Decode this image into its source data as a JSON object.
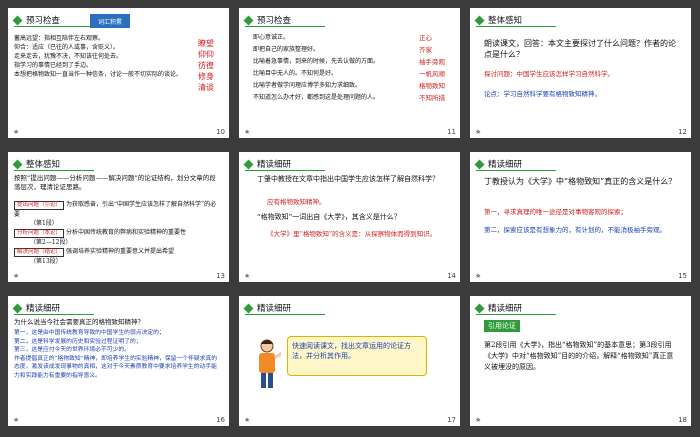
{
  "slides": [
    {
      "num": "10",
      "title": "预习检查",
      "banner": "词汇积累",
      "lines": [
        "蓄高远望：指相互陪伴左右观察。",
        "仰合：适应（已往的人或事，含贬义）。",
        "走来走去，犹豫不决，不知该往何处去。",
        "指学习的事情已经到了手边。",
        "本想把格物致知一直当作一种信条，讨论一般不切实际的谈论。"
      ],
      "side": [
        "瞭望",
        "仰仰",
        "彷徨",
        "修身",
        "清谈"
      ]
    },
    {
      "num": "11",
      "title": "预习检查",
      "lines": [
        "即心意诚正。",
        "即把自己的家族整理好。",
        "比喻着急事情，到来的时候，先去认做的方面。",
        "比喻目中无人的。不知何是好。",
        "比喻学者做学问理应博学多知力求细致。",
        "不知道怎么办才好，都感到这是处理问题的人。"
      ],
      "side": [
        "正心",
        "齐家",
        "袖手旁观",
        "一帆风顺",
        "格物致知",
        "不知所措"
      ]
    },
    {
      "num": "12",
      "title": "整体感知",
      "q": "朗读课文，回答：本文主要探讨了什么问题？作者的论点是什么？",
      "a1": "探讨问题：中国学生应该怎样学习自然科学。",
      "a2": "论点：学习自然科学要有格物致知精神。"
    },
    {
      "num": "13",
      "title": "整体感知",
      "intro": "按照“提出问题——分析问题——解决问题”的论证结构，划分文章的段落层次，理清论证思路。",
      "parts": [
        {
          "label": "提出问题（引论）",
          "range": "（第1段）",
          "desc": "为获取感奋，引出“中国学生应该怎样了解自然科学”的必要"
        },
        {
          "label": "分析问题（本论）",
          "range": "（第2—12段）",
          "desc": "分析中国传统教育的弊病和实验精神的重要性"
        },
        {
          "label": "解决问题（结论）",
          "range": "（第13段）",
          "desc": "强调培养实验精神的重要意义并提出希望"
        }
      ]
    },
    {
      "num": "14",
      "title": "精读细研",
      "q1": "丁肇中教授在文章中指出中国学生应该怎样了解自然科学？",
      "a1": "应有格物致知精神。",
      "q2": "“格物致知”一词出自《大学》，其含义是什么？",
      "a2": "《大学》里“格物致知”的含义是：从探察物体而得到知识。"
    },
    {
      "num": "15",
      "title": "精读细研",
      "q": "丁教授认为《大学》中“格物致知”真正的含义是什么？",
      "a1": "第一，寻求真理的唯一途径是对事物客观的探索；",
      "a2": "第二，探索应该是有想象力的，有计划的，不能消极袖手旁观。"
    },
    {
      "num": "16",
      "title": "精读细研",
      "q": "为什么说当今社会需要真正的格物致知精神？",
      "lines": [
        "第一，这是由中国传统教育导致的中国学生的弱点决定的；",
        "第二，这是科学发展的历史和实验过程证明了的；",
        "第三，这是应付今天的世界环境必不可少的。",
        "作者提倡真正的“格物致知”精神，即培养学生的实验精神，保留一个怀疑求真的态度，激发该成发现事物的真相，这对于今天素质教育中要求培养学生的动手能力和实践能力有重要的指导意义。"
      ]
    },
    {
      "num": "17",
      "title": "精读细研",
      "bubble": "快速阅读课文，找出文章运用的论证方法，并分析其作用。"
    },
    {
      "num": "18",
      "title": "精读细研",
      "tag": "引用论证",
      "text": "第2段引用《大学》，指出“格物致知”的基本意思；第3段引用《大学》中对“格物致知”目的的介绍，解释“格物致知”真正意义被埋没的原因。"
    }
  ]
}
